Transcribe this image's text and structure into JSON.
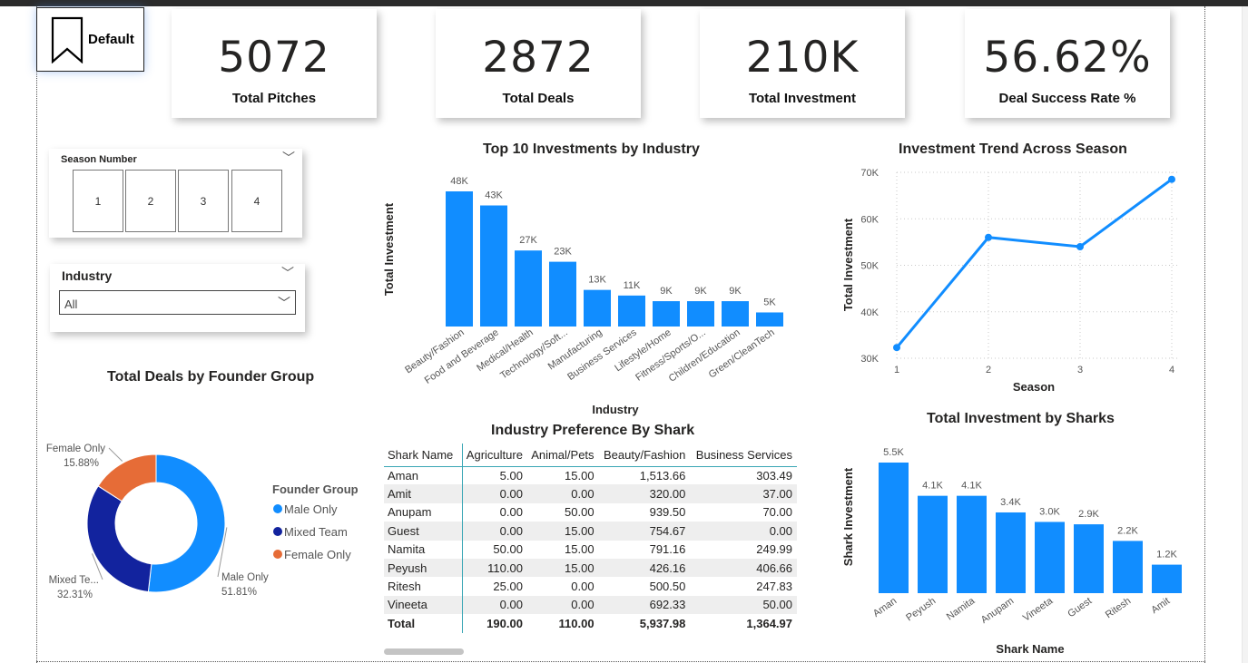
{
  "bookmark": {
    "label": "Default"
  },
  "kpis": [
    {
      "value": "5072",
      "caption": "Total Pitches"
    },
    {
      "value": "2872",
      "caption": "Total Deals"
    },
    {
      "value": "210K",
      "caption": "Total Investment"
    },
    {
      "value": "56.62%",
      "caption": "Deal Success Rate %"
    }
  ],
  "slicers": {
    "season": {
      "title": "Season Number",
      "options": [
        "1",
        "2",
        "3",
        "4"
      ]
    },
    "industry": {
      "title": "Industry",
      "selected": "All"
    }
  },
  "titles": {
    "industry_chart": "Top 10 Investments by Industry",
    "trend_chart": "Investment Trend Across Season",
    "founder_chart": "Total Deals by Founder Group",
    "table": "Industry Preference By Shark",
    "sharks_chart": "Total Investment by Sharks"
  },
  "colors": {
    "accent": "#118dff",
    "dark_blue": "#12239e",
    "orange": "#e66c37",
    "teal_rule": "#3aa6b5"
  },
  "chart_data": [
    {
      "type": "bar",
      "title": "Top 10 Investments by Industry",
      "xlabel": "Industry",
      "ylabel": "Total Investment",
      "categories": [
        "Beauty/Fashion",
        "Food and Beverage",
        "Medical/Health",
        "Technology/Soft...",
        "Manufacturing",
        "Business Services",
        "Lifestyle/Home",
        "Fitness/Sports/O...",
        "Children/Education",
        "Green/CleanTech"
      ],
      "values": [
        48000,
        43000,
        27000,
        23000,
        13000,
        11000,
        9000,
        9000,
        9000,
        5000
      ],
      "data_labels": [
        "48K",
        "43K",
        "27K",
        "23K",
        "13K",
        "11K",
        "9K",
        "9K",
        "9K",
        "5K"
      ],
      "ylim": [
        0,
        48000
      ]
    },
    {
      "type": "line",
      "title": "Investment Trend Across Season",
      "xlabel": "Season",
      "ylabel": "Total Investment",
      "x": [
        1,
        2,
        3,
        4
      ],
      "values": [
        32300,
        56000,
        54000,
        68500
      ],
      "yticks": [
        "30K",
        "40K",
        "50K",
        "60K",
        "70K"
      ],
      "xticks": [
        "1",
        "2",
        "3",
        "4"
      ],
      "ylim": [
        30000,
        70000
      ],
      "grid": true
    },
    {
      "type": "pie",
      "title": "Total Deals by Founder Group",
      "legend_title": "Founder Group",
      "legend_position": "right",
      "categories": [
        "Male Only",
        "Mixed Team",
        "Female Only"
      ],
      "values": [
        51.81,
        32.31,
        15.88
      ],
      "slice_labels": [
        "Male Only",
        "Mixed Te...",
        "Female Only"
      ],
      "percent_labels": [
        "51.81%",
        "32.31%",
        "15.88%"
      ]
    },
    {
      "type": "table",
      "title": "Industry Preference By Shark",
      "columns": [
        "Shark Name",
        "Agriculture",
        "Animal/Pets",
        "Beauty/Fashion",
        "Business Services"
      ],
      "rows": [
        [
          "Aman",
          "5.00",
          "15.00",
          "1,513.66",
          "303.49"
        ],
        [
          "Amit",
          "0.00",
          "0.00",
          "320.00",
          "37.00"
        ],
        [
          "Anupam",
          "0.00",
          "50.00",
          "939.50",
          "70.00"
        ],
        [
          "Guest",
          "0.00",
          "15.00",
          "754.67",
          "0.00"
        ],
        [
          "Namita",
          "50.00",
          "15.00",
          "791.16",
          "249.99"
        ],
        [
          "Peyush",
          "110.00",
          "15.00",
          "426.16",
          "406.66"
        ],
        [
          "Ritesh",
          "25.00",
          "0.00",
          "500.50",
          "247.83"
        ],
        [
          "Vineeta",
          "0.00",
          "0.00",
          "692.33",
          "50.00"
        ]
      ],
      "total": [
        "Total",
        "190.00",
        "110.00",
        "5,937.98",
        "1,364.97"
      ]
    },
    {
      "type": "bar",
      "title": "Total Investment by Sharks",
      "xlabel": "Shark Name",
      "ylabel": "Shark Investment",
      "categories": [
        "Aman",
        "Peyush",
        "Namita",
        "Anupam",
        "Vineeta",
        "Guest",
        "Ritesh",
        "Amit"
      ],
      "values": [
        5500,
        4100,
        4100,
        3400,
        3000,
        2900,
        2200,
        1200
      ],
      "data_labels": [
        "5.5K",
        "4.1K",
        "4.1K",
        "3.4K",
        "3.0K",
        "2.9K",
        "2.2K",
        "1.2K"
      ],
      "ylim": [
        0,
        5500
      ]
    }
  ]
}
